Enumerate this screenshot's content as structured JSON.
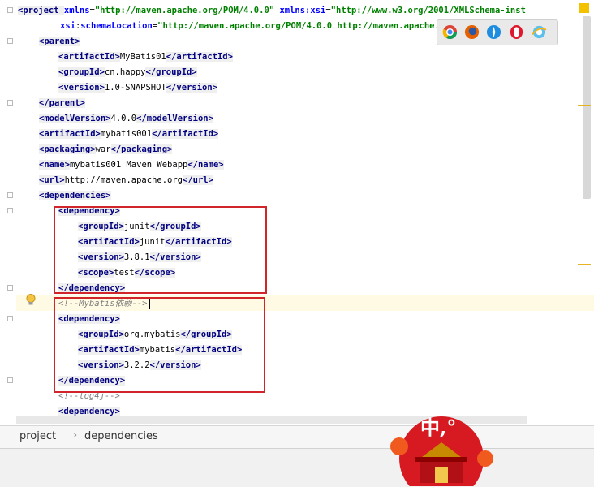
{
  "colors": {
    "tag": "#000080",
    "attribute": "#0000ff",
    "value": "#008000",
    "comment": "#808080",
    "highlight_box": "#d0252b",
    "current_line": "#fffae3"
  },
  "editor": {
    "lines": [
      {
        "key": "project-open",
        "parts": [
          [
            "tag",
            "<project "
          ],
          [
            "attr",
            "xmlns"
          ],
          [
            "txt",
            "="
          ],
          [
            "val",
            "\"http://maven.apache.org/POM/4.0.0\""
          ],
          [
            "txt",
            " "
          ],
          [
            "attr",
            "xmlns:xsi"
          ],
          [
            "txt",
            "="
          ],
          [
            "val",
            "\"http://www.w3.org/2001/XMLSchema-inst"
          ]
        ]
      },
      {
        "key": "schema-location",
        "parts": [
          [
            "attr",
            "xsi"
          ],
          [
            "txt",
            ":"
          ],
          [
            "attr",
            "schemaLocation"
          ],
          [
            "txt",
            "="
          ],
          [
            "val",
            "\"http://maven.apache.org/POM/4.0.0 http://maven.apache.org/maven-v4_0_0.xs"
          ]
        ]
      },
      {
        "key": "parent-open",
        "parts": [
          [
            "tag",
            "<parent>"
          ]
        ]
      },
      {
        "key": "parent-artifactId",
        "parts": [
          [
            "tag",
            "<artifactId>"
          ],
          [
            "txt",
            "MyBatis01"
          ],
          [
            "tag",
            "</artifactId>"
          ]
        ]
      },
      {
        "key": "parent-groupId",
        "parts": [
          [
            "tag",
            "<groupId>"
          ],
          [
            "txt",
            "cn.happy"
          ],
          [
            "tag",
            "</groupId>"
          ]
        ]
      },
      {
        "key": "parent-version",
        "parts": [
          [
            "tag",
            "<version>"
          ],
          [
            "txt",
            "1.0-SNAPSHOT"
          ],
          [
            "tag",
            "</version>"
          ]
        ]
      },
      {
        "key": "parent-close",
        "parts": [
          [
            "tag",
            "</parent>"
          ]
        ]
      },
      {
        "key": "modelVersion",
        "parts": [
          [
            "tag",
            "<modelVersion>"
          ],
          [
            "txt",
            "4.0.0"
          ],
          [
            "tag",
            "</modelVersion>"
          ]
        ]
      },
      {
        "key": "artifactId",
        "parts": [
          [
            "tag",
            "<artifactId>"
          ],
          [
            "txt",
            "mybatis001"
          ],
          [
            "tag",
            "</artifactId>"
          ]
        ]
      },
      {
        "key": "packaging",
        "parts": [
          [
            "tag",
            "<packaging>"
          ],
          [
            "txt",
            "war"
          ],
          [
            "tag",
            "</packaging>"
          ]
        ]
      },
      {
        "key": "name",
        "parts": [
          [
            "tag",
            "<name>"
          ],
          [
            "txt",
            "mybatis001 Maven Webapp"
          ],
          [
            "tag",
            "</name>"
          ]
        ]
      },
      {
        "key": "url",
        "parts": [
          [
            "tag",
            "<url>"
          ],
          [
            "txt",
            "http://maven.apache.org"
          ],
          [
            "tag",
            "</url>"
          ]
        ]
      },
      {
        "key": "dependencies-open",
        "parts": [
          [
            "tag",
            "<dependencies>"
          ]
        ]
      },
      {
        "key": "dep1-open",
        "parts": [
          [
            "tag",
            "<dependency>"
          ]
        ]
      },
      {
        "key": "dep1-groupId",
        "parts": [
          [
            "tag",
            "<groupId>"
          ],
          [
            "txt",
            "junit"
          ],
          [
            "tag",
            "</groupId>"
          ]
        ]
      },
      {
        "key": "dep1-artifactId",
        "parts": [
          [
            "tag",
            "<artifactId>"
          ],
          [
            "txt",
            "junit"
          ],
          [
            "tag",
            "</artifactId>"
          ]
        ]
      },
      {
        "key": "dep1-version",
        "parts": [
          [
            "tag",
            "<version>"
          ],
          [
            "txt",
            "3.8.1"
          ],
          [
            "tag",
            "</version>"
          ]
        ]
      },
      {
        "key": "dep1-scope",
        "parts": [
          [
            "tag",
            "<scope>"
          ],
          [
            "txt",
            "test"
          ],
          [
            "tag",
            "</scope>"
          ]
        ]
      },
      {
        "key": "dep1-close",
        "parts": [
          [
            "tag",
            "</dependency>"
          ]
        ]
      },
      {
        "key": "comment-mybatis",
        "parts": [
          [
            "cmt",
            "<!--Mybatis依赖-->"
          ]
        ]
      },
      {
        "key": "dep2-open",
        "parts": [
          [
            "tag",
            "<dependency>"
          ]
        ]
      },
      {
        "key": "dep2-groupId",
        "parts": [
          [
            "tag",
            "<groupId>"
          ],
          [
            "txt",
            "org.mybatis"
          ],
          [
            "tag",
            "</groupId>"
          ]
        ]
      },
      {
        "key": "dep2-artifactId",
        "parts": [
          [
            "tag",
            "<artifactId>"
          ],
          [
            "txt",
            "mybatis"
          ],
          [
            "tag",
            "</artifactId>"
          ]
        ]
      },
      {
        "key": "dep2-version",
        "parts": [
          [
            "tag",
            "<version>"
          ],
          [
            "txt",
            "3.2.2"
          ],
          [
            "tag",
            "</version>"
          ]
        ]
      },
      {
        "key": "dep2-close",
        "parts": [
          [
            "tag",
            "</dependency>"
          ]
        ]
      },
      {
        "key": "comment-log4j",
        "parts": [
          [
            "cmt",
            "<!--log4j-->"
          ]
        ]
      },
      {
        "key": "dep3-open",
        "parts": [
          [
            "tag",
            "<dependency>"
          ]
        ]
      }
    ]
  },
  "breadcrumb": {
    "items": [
      "project",
      "dependencies"
    ],
    "separator": "›"
  },
  "browser_icons": [
    "chrome-icon",
    "firefox-icon",
    "safari-icon",
    "opera-icon",
    "ie-icon"
  ],
  "badge": {
    "text": "中,°"
  }
}
